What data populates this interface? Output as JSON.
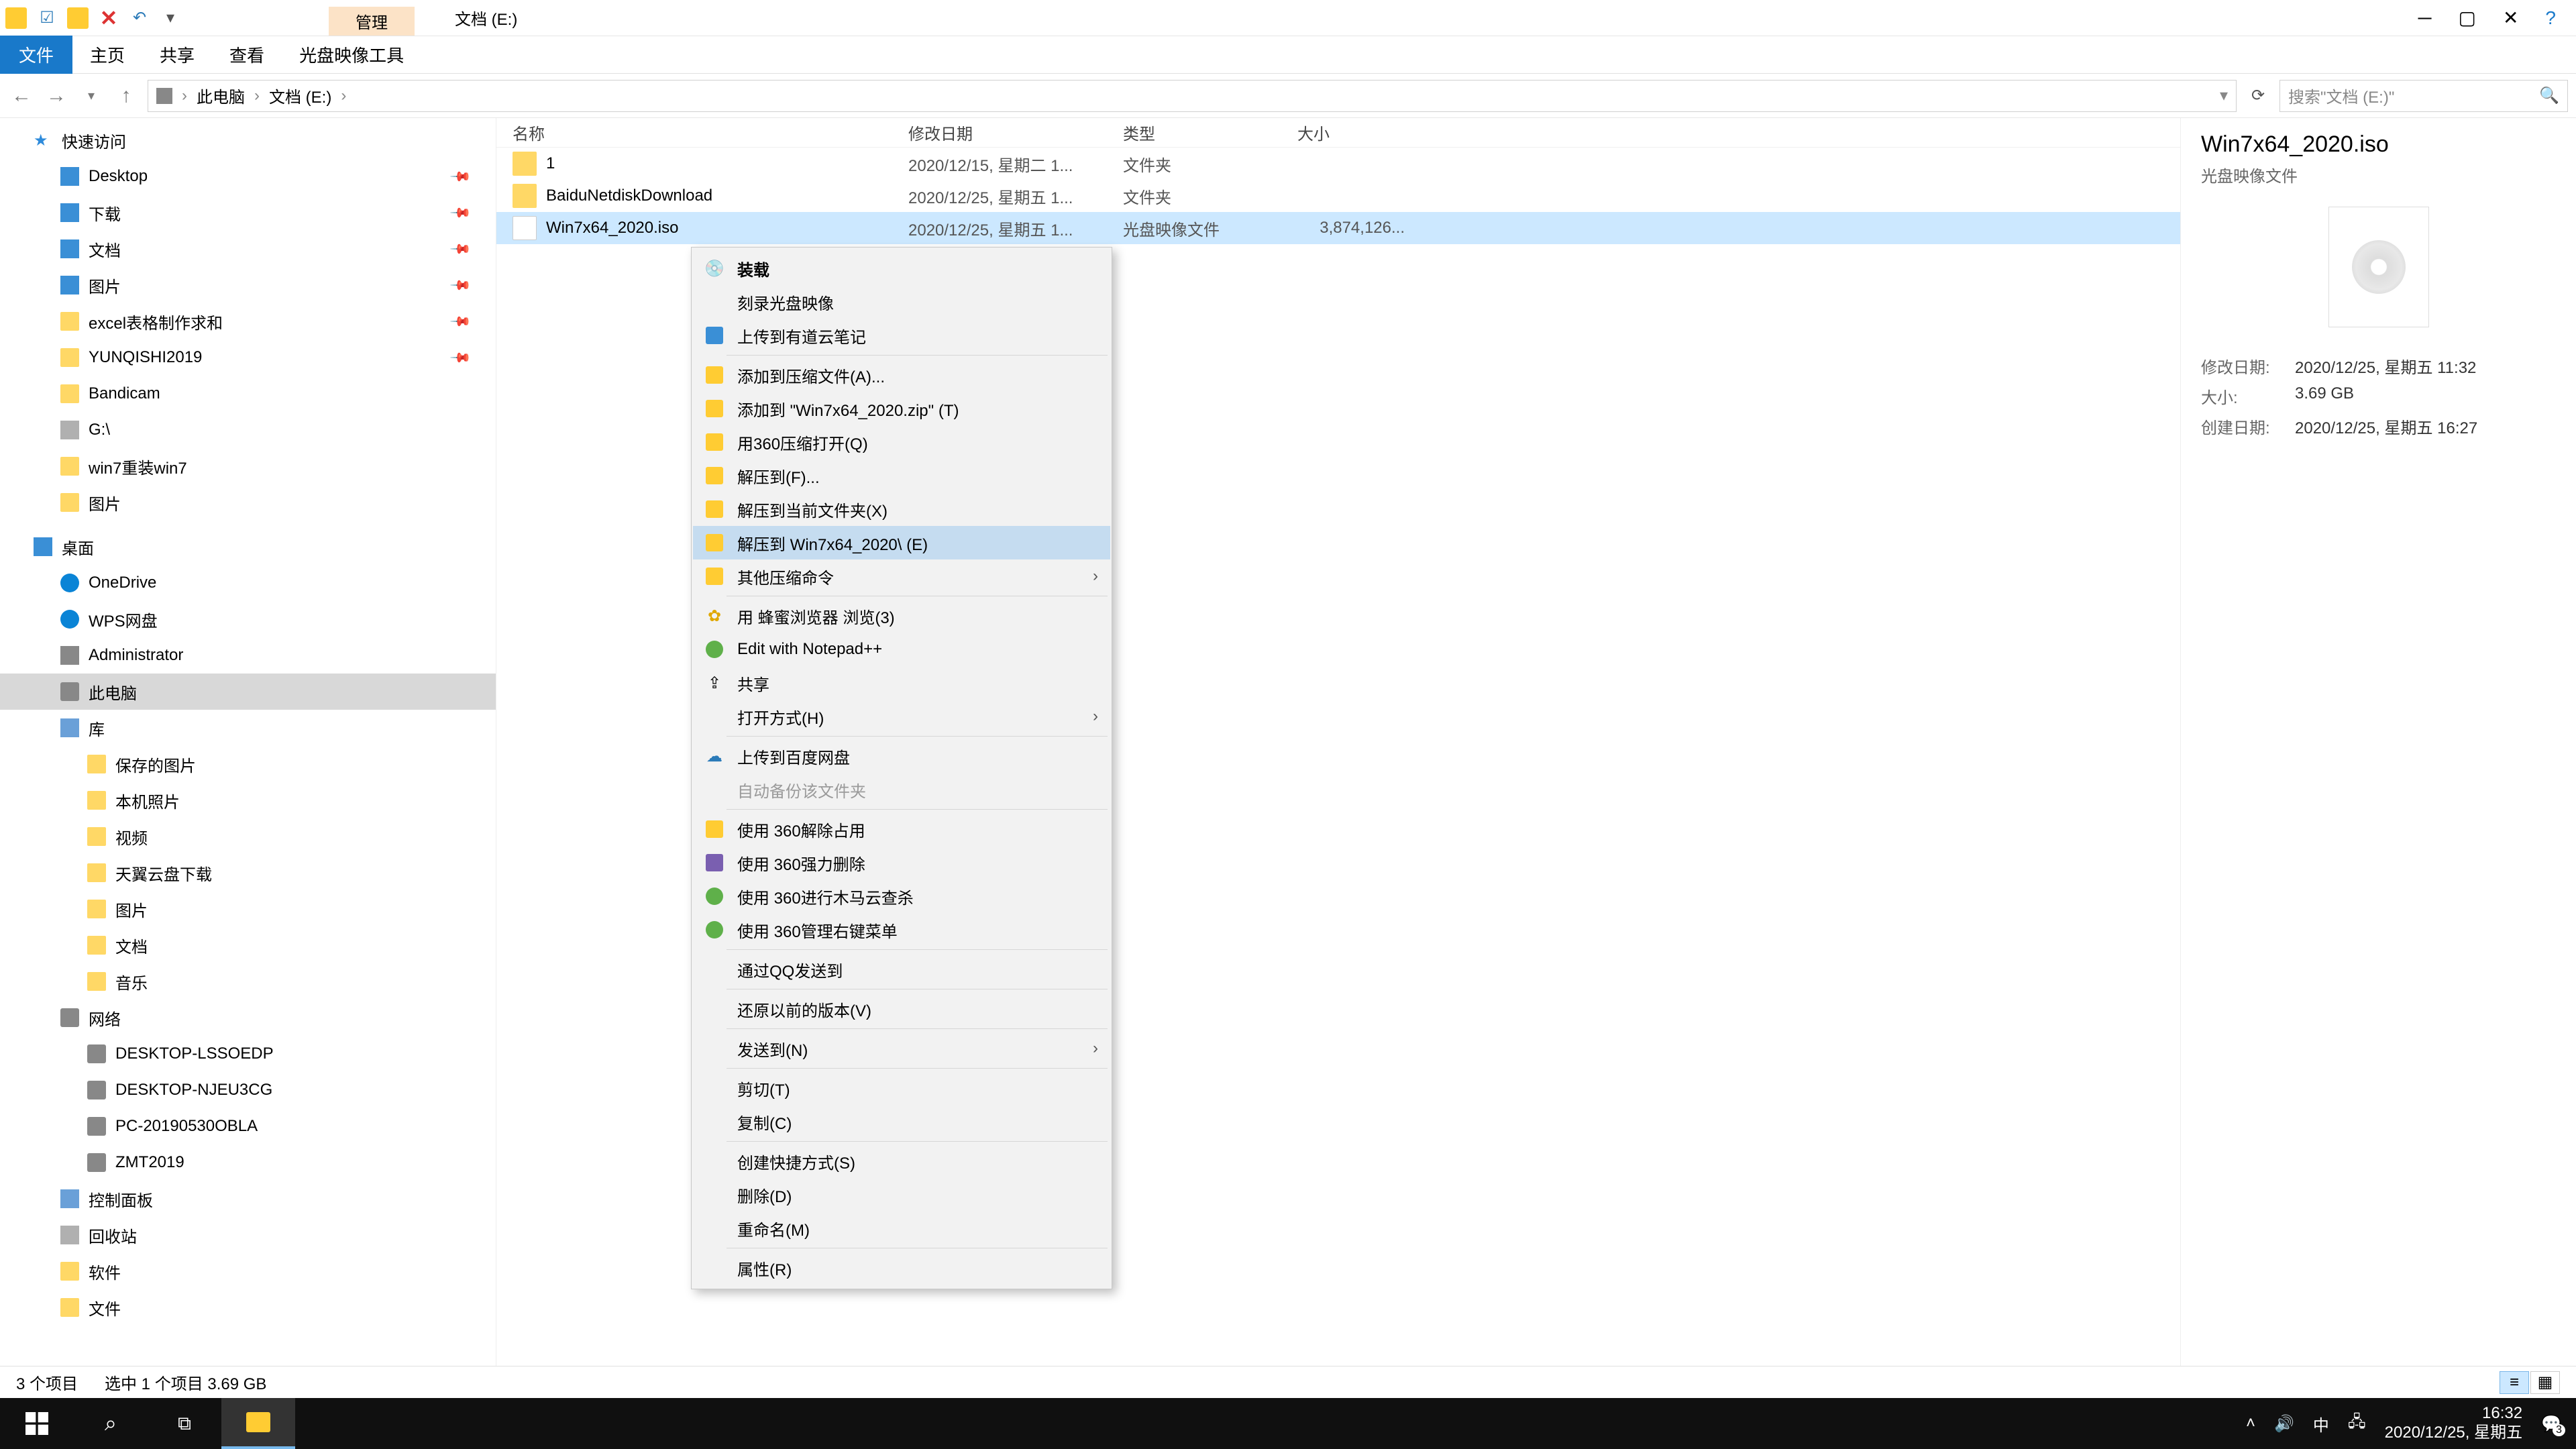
{
  "titlebar": {
    "context_tab": "管理",
    "title": "文档 (E:)"
  },
  "ribbon": {
    "file": "文件",
    "tabs": [
      "主页",
      "共享",
      "查看",
      "光盘映像工具"
    ]
  },
  "breadcrumb": {
    "root": "此电脑",
    "loc": "文档 (E:)"
  },
  "search": {
    "placeholder": "搜索\"文档 (E:)\""
  },
  "tree": {
    "quick": "快速访问",
    "quick_items": [
      "Desktop",
      "下载",
      "文档",
      "图片",
      "excel表格制作求和",
      "YUNQISHI2019",
      "Bandicam",
      "G:\\",
      "win7重装win7",
      "图片"
    ],
    "desktop": "桌面",
    "desktop_items": [
      "OneDrive",
      "WPS网盘",
      "Administrator",
      "此电脑",
      "库"
    ],
    "lib_items": [
      "保存的图片",
      "本机照片",
      "视频",
      "天翼云盘下载",
      "图片",
      "文档",
      "音乐"
    ],
    "network": "网络",
    "net_items": [
      "DESKTOP-LSSOEDP",
      "DESKTOP-NJEU3CG",
      "PC-20190530OBLA",
      "ZMT2019"
    ],
    "misc": [
      "控制面板",
      "回收站",
      "软件",
      "文件"
    ]
  },
  "columns": {
    "name": "名称",
    "date": "修改日期",
    "type": "类型",
    "size": "大小"
  },
  "rows": [
    {
      "name": "1",
      "date": "2020/12/15, 星期二 1...",
      "type": "文件夹",
      "size": ""
    },
    {
      "name": "BaiduNetdiskDownload",
      "date": "2020/12/25, 星期五 1...",
      "type": "文件夹",
      "size": ""
    },
    {
      "name": "Win7x64_2020.iso",
      "date": "2020/12/25, 星期五 1...",
      "type": "光盘映像文件",
      "size": "3,874,126..."
    }
  ],
  "context": {
    "g1": [
      "装载",
      "刻录光盘映像",
      "上传到有道云笔记"
    ],
    "g2": [
      "添加到压缩文件(A)...",
      "添加到 \"Win7x64_2020.zip\" (T)",
      "用360压缩打开(Q)",
      "解压到(F)...",
      "解压到当前文件夹(X)",
      "解压到 Win7x64_2020\\ (E)",
      "其他压缩命令"
    ],
    "g3": [
      "用 蜂蜜浏览器 浏览(3)",
      "Edit with Notepad++",
      "共享",
      "打开方式(H)"
    ],
    "g4": [
      "上传到百度网盘",
      "自动备份该文件夹"
    ],
    "g5": [
      "使用 360解除占用",
      "使用 360强力删除",
      "使用 360进行木马云查杀",
      "使用 360管理右键菜单"
    ],
    "g6": [
      "通过QQ发送到"
    ],
    "g7": [
      "还原以前的版本(V)"
    ],
    "g8": [
      "发送到(N)"
    ],
    "g9": [
      "剪切(T)",
      "复制(C)"
    ],
    "g10": [
      "创建快捷方式(S)",
      "删除(D)",
      "重命名(M)"
    ],
    "g11": [
      "属性(R)"
    ]
  },
  "details": {
    "title": "Win7x64_2020.iso",
    "subtitle": "光盘映像文件",
    "props": [
      {
        "k": "修改日期:",
        "v": "2020/12/25, 星期五 11:32"
      },
      {
        "k": "大小:",
        "v": "3.69 GB"
      },
      {
        "k": "创建日期:",
        "v": "2020/12/25, 星期五 16:27"
      }
    ]
  },
  "status": {
    "count": "3 个项目",
    "sel": "选中 1 个项目  3.69 GB"
  },
  "taskbar": {
    "time": "16:32",
    "date": "2020/12/25, 星期五",
    "ime": "中",
    "badge": "3"
  }
}
